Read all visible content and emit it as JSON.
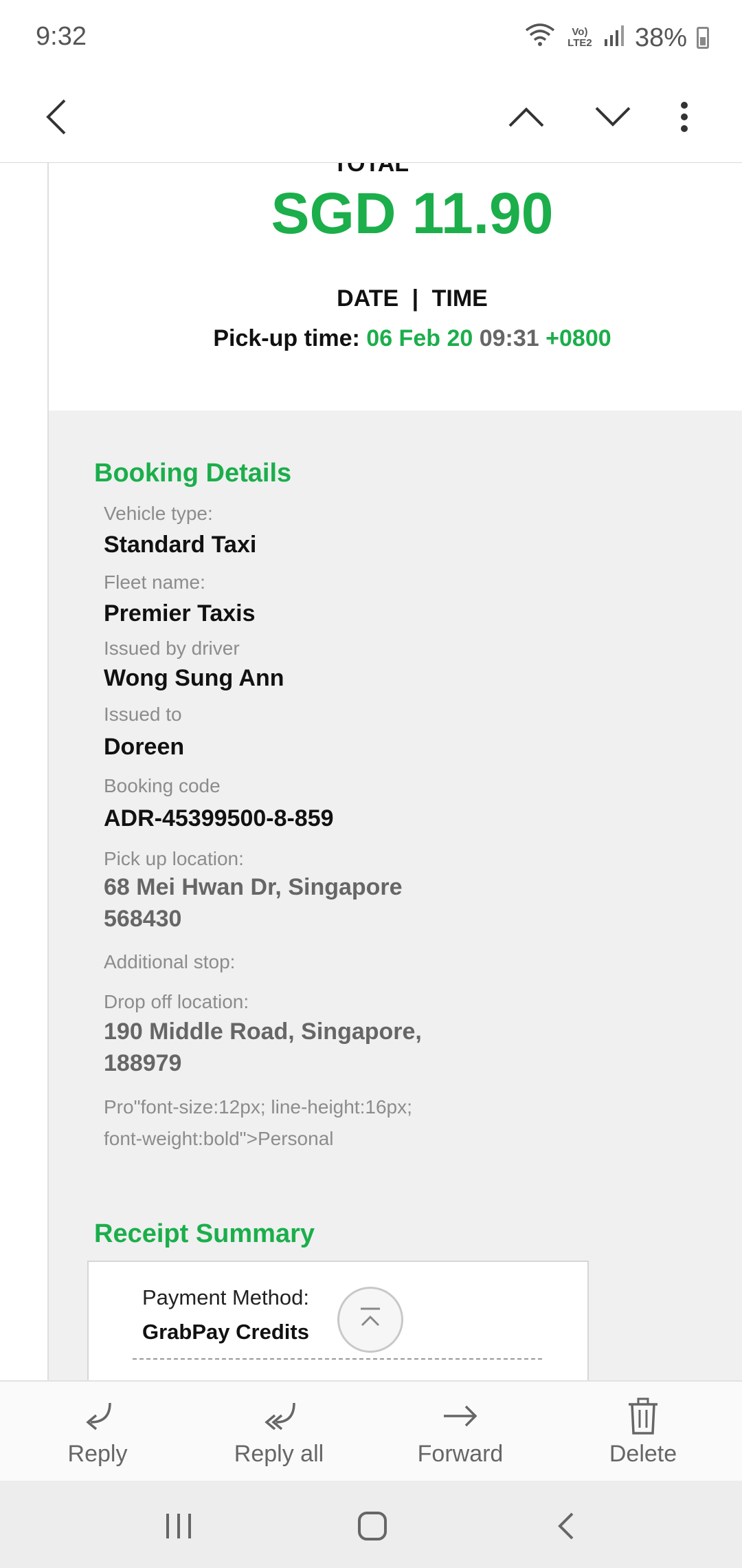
{
  "status_bar": {
    "time": "9:32",
    "network": "Vo) LTE2",
    "battery": "38%",
    "icons": [
      "wifi-icon",
      "signal-icon",
      "battery-icon"
    ]
  },
  "toolbar": {
    "icons": [
      "back-arrow-icon",
      "chevron-up-icon",
      "chevron-down-icon",
      "more-vertical-icon"
    ]
  },
  "receipt": {
    "total_label": "TOTAL",
    "amount": "SGD 11.90",
    "date_label": "DATE",
    "separator": "|",
    "time_label": "TIME",
    "pickup_label": "Pick-up time:",
    "pickup_date": "06 Feb 20",
    "pickup_time": "09:31",
    "pickup_tz": "+0800"
  },
  "booking": {
    "title": "Booking Details",
    "vehicle_label": "Vehicle type:",
    "vehicle": "Standard Taxi",
    "fleet_label": "Fleet name:",
    "fleet": "Premier Taxis",
    "driver_label": "Issued by driver",
    "driver": "Wong Sung Ann",
    "issued_to_label": "Issued to",
    "issued_to": "Doreen",
    "code_label": "Booking code",
    "code": "ADR-45399500-8-859",
    "pickup_loc_label": "Pick up location:",
    "pickup_loc_line1": "68 Mei Hwan Dr, Singapore",
    "pickup_loc_line2": "568430",
    "stop_label": "Additional stop:",
    "dropoff_label": "Drop off location:",
    "dropoff_line1": "190 Middle Road, Singapore,",
    "dropoff_line2": "188979",
    "profile_line1": "Pro\"font-size:12px; line-height:16px;",
    "profile_line2": "font-weight:bold\">Personal"
  },
  "summary": {
    "title": "Receipt Summary",
    "payment_label": "Payment Method:",
    "payment_value": "GrabPay Credits"
  },
  "actions": {
    "reply": "Reply",
    "reply_all": "Reply all",
    "forward": "Forward",
    "delete": "Delete"
  },
  "colors": {
    "accent": "#1bae4b",
    "panel": "#f0f0f0"
  }
}
